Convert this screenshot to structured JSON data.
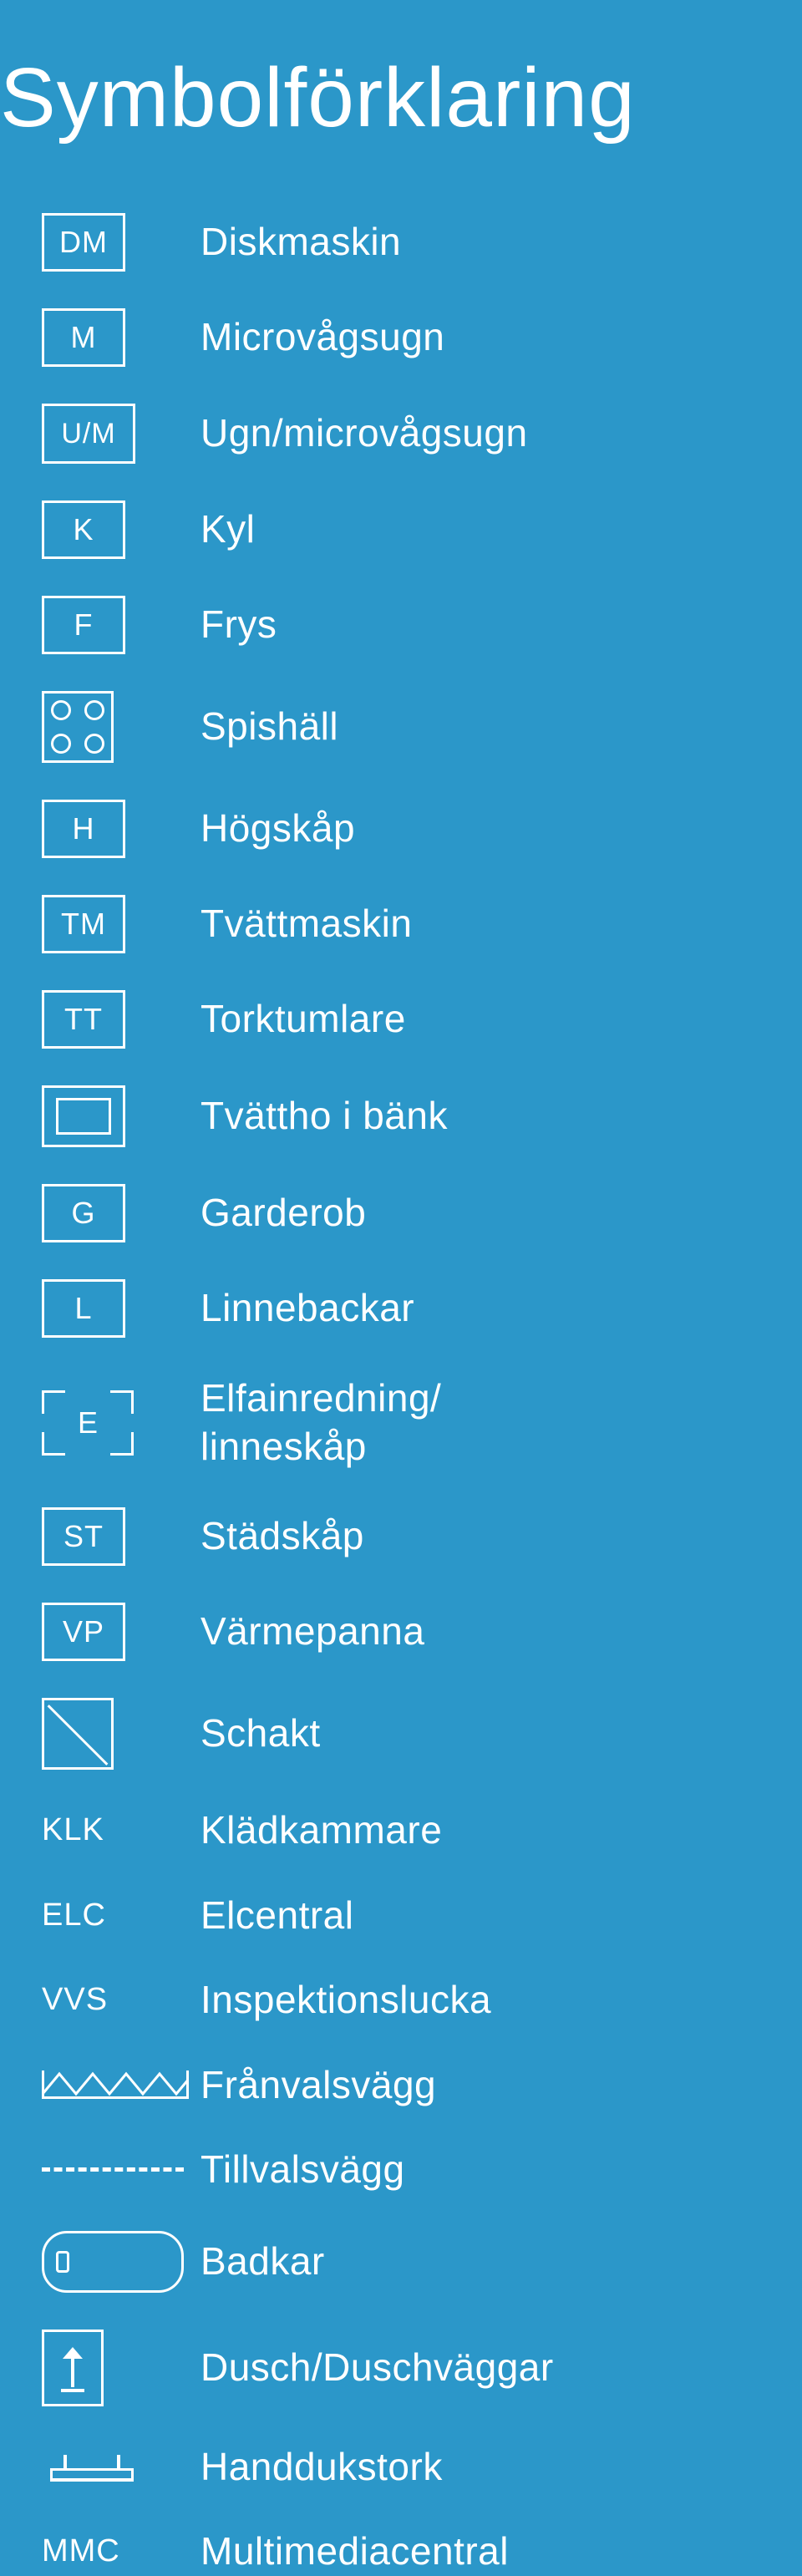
{
  "title": "Symbolförklaring",
  "rows": [
    {
      "sym_text": "DM",
      "label": "Diskmaskin"
    },
    {
      "sym_text": "M",
      "label": "Microvågsugn"
    },
    {
      "sym_text": "U/M",
      "label": "Ugn/microvågsugn"
    },
    {
      "sym_text": "K",
      "label": "Kyl"
    },
    {
      "sym_text": "F",
      "label": "Frys"
    },
    {
      "sym_text": "",
      "label": "Spishäll"
    },
    {
      "sym_text": "H",
      "label": "Högskåp"
    },
    {
      "sym_text": "TM",
      "label": "Tvättmaskin"
    },
    {
      "sym_text": "TT",
      "label": "Torktumlare"
    },
    {
      "sym_text": "",
      "label": "Tvättho i bänk"
    },
    {
      "sym_text": "G",
      "label": "Garderob"
    },
    {
      "sym_text": "L",
      "label": "Linnebackar"
    },
    {
      "sym_text": "E",
      "label": "Elfainredning/\nlinneskåp"
    },
    {
      "sym_text": "ST",
      "label": "Städskåp"
    },
    {
      "sym_text": "VP",
      "label": "Värmepanna"
    },
    {
      "sym_text": "",
      "label": "Schakt"
    },
    {
      "sym_text": "KLK",
      "label": "Klädkammare"
    },
    {
      "sym_text": "ELC",
      "label": "Elcentral"
    },
    {
      "sym_text": "VVS",
      "label": "Inspektionslucka"
    },
    {
      "sym_text": "",
      "label": "Frånvalsvägg"
    },
    {
      "sym_text": "",
      "label": "Tillvalsvägg"
    },
    {
      "sym_text": "",
      "label": "Badkar"
    },
    {
      "sym_text": "",
      "label": "Dusch/Duschväggar"
    },
    {
      "sym_text": "",
      "label": "Handdukstork"
    },
    {
      "sym_text": "MMC",
      "label": "Multimediacentral"
    }
  ]
}
